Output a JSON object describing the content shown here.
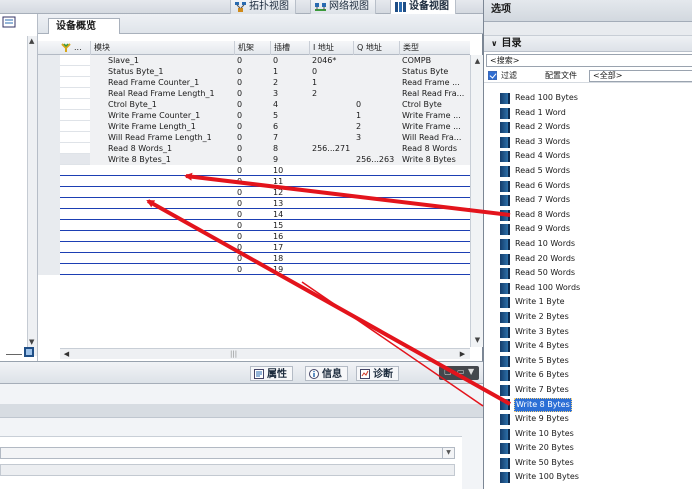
{
  "view_tabs": [
    {
      "label": "拓扑视图"
    },
    {
      "label": "网络视图"
    },
    {
      "label": "设备视图"
    }
  ],
  "overview": {
    "tab_label": "设备概览",
    "columns": [
      "模块",
      "机架",
      "插槽",
      "I 地址",
      "Q 地址",
      "类型"
    ],
    "rows": [
      {
        "module": "Slave_1",
        "rack": "0",
        "slot": "0",
        "i_addr": "2046*",
        "q_addr": "",
        "type": "COMPB"
      },
      {
        "module": "Status Byte_1",
        "rack": "0",
        "slot": "1",
        "i_addr": "0",
        "q_addr": "",
        "type": "Status Byte"
      },
      {
        "module": "Read Frame Counter_1",
        "rack": "0",
        "slot": "2",
        "i_addr": "1",
        "q_addr": "",
        "type": "Read Frame ..."
      },
      {
        "module": "Real Read Frame Length_1",
        "rack": "0",
        "slot": "3",
        "i_addr": "2",
        "q_addr": "",
        "type": "Real Read Fra..."
      },
      {
        "module": "Ctrol Byte_1",
        "rack": "0",
        "slot": "4",
        "i_addr": "",
        "q_addr": "0",
        "type": "Ctrol Byte"
      },
      {
        "module": "Write Frame Counter_1",
        "rack": "0",
        "slot": "5",
        "i_addr": "",
        "q_addr": "1",
        "type": "Write Frame ..."
      },
      {
        "module": "Write Frame Length_1",
        "rack": "0",
        "slot": "6",
        "i_addr": "",
        "q_addr": "2",
        "type": "Write Frame ..."
      },
      {
        "module": "Will Read Frame Length_1",
        "rack": "0",
        "slot": "7",
        "i_addr": "",
        "q_addr": "3",
        "type": "Will Read Fra..."
      },
      {
        "module": "Read 8 Words_1",
        "rack": "0",
        "slot": "8",
        "i_addr": "256...271",
        "q_addr": "",
        "type": "Read 8 Words"
      },
      {
        "module": "Write 8 Bytes_1",
        "rack": "0",
        "slot": "9",
        "i_addr": "",
        "q_addr": "256...263",
        "type": "Write 8 Bytes"
      },
      {
        "module": "",
        "rack": "0",
        "slot": "10",
        "i_addr": "",
        "q_addr": "",
        "type": ""
      },
      {
        "module": "",
        "rack": "0",
        "slot": "11",
        "i_addr": "",
        "q_addr": "",
        "type": ""
      },
      {
        "module": "",
        "rack": "0",
        "slot": "12",
        "i_addr": "",
        "q_addr": "",
        "type": ""
      },
      {
        "module": "",
        "rack": "0",
        "slot": "13",
        "i_addr": "",
        "q_addr": "",
        "type": ""
      },
      {
        "module": "",
        "rack": "0",
        "slot": "14",
        "i_addr": "",
        "q_addr": "",
        "type": ""
      },
      {
        "module": "",
        "rack": "0",
        "slot": "15",
        "i_addr": "",
        "q_addr": "",
        "type": ""
      },
      {
        "module": "",
        "rack": "0",
        "slot": "16",
        "i_addr": "",
        "q_addr": "",
        "type": ""
      },
      {
        "module": "",
        "rack": "0",
        "slot": "17",
        "i_addr": "",
        "q_addr": "",
        "type": ""
      },
      {
        "module": "",
        "rack": "0",
        "slot": "18",
        "i_addr": "",
        "q_addr": "",
        "type": ""
      },
      {
        "module": "",
        "rack": "0",
        "slot": "19",
        "i_addr": "",
        "q_addr": "",
        "type": ""
      }
    ]
  },
  "inspector": {
    "tabs": [
      {
        "label": "属性"
      },
      {
        "label": "信息"
      },
      {
        "label": "诊断"
      }
    ]
  },
  "catalog": {
    "title": "选项",
    "section": "目录",
    "search_placeholder": "<搜索>",
    "filter_label": "过滤",
    "profile_label": "配置文件",
    "profile_value": "<全部>",
    "items": [
      "Read 100 Bytes",
      "Read 1 Word",
      "Read 2 Words",
      "Read 3 Words",
      "Read 4 Words",
      "Read 5 Words",
      "Read 6 Words",
      "Read 7 Words",
      "Read 8 Words",
      "Read 9 Words",
      "Read 10 Words",
      "Read 20 Words",
      "Read 50 Words",
      "Read 100 Words",
      "Write 1 Byte",
      "Write 2 Bytes",
      "Write 3 Bytes",
      "Write 4 Bytes",
      "Write 5 Bytes",
      "Write 6 Bytes",
      "Write 7 Bytes",
      "Write 8 Bytes",
      "Write 9 Bytes",
      "Write 10 Bytes",
      "Write 20 Bytes",
      "Write 50 Bytes",
      "Write 100 Bytes"
    ],
    "selected_item": "Write 8 Bytes"
  },
  "colors": {
    "arrow": "#e3141c",
    "empty_row_line": "#1d3fb3",
    "selection": "#2c6fd6"
  }
}
